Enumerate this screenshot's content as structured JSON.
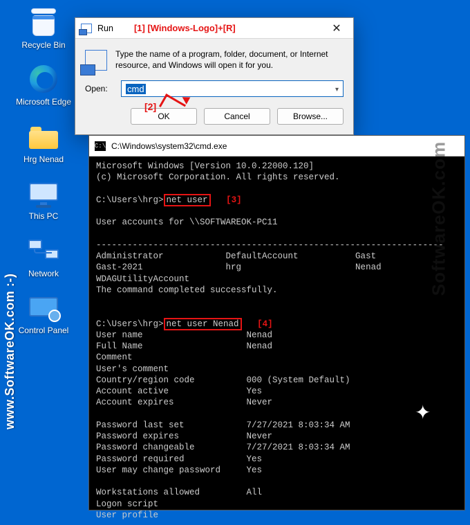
{
  "desktop": {
    "icons": [
      {
        "label": "Recycle Bin"
      },
      {
        "label": "Microsoft Edge"
      },
      {
        "label": "Hrg Nenad"
      },
      {
        "label": "This PC"
      },
      {
        "label": "Network"
      },
      {
        "label": "Control Panel"
      }
    ]
  },
  "annotations": {
    "a1": "[1]  [Windows-Logo]+[R]",
    "a2": "[2]",
    "a3": "[3]",
    "a4": "[4]"
  },
  "run": {
    "title": "Run",
    "description": "Type the name of a program, folder, document, or Internet resource, and Windows will open it for you.",
    "open_label": "Open:",
    "input_value": "cmd",
    "ok": "OK",
    "cancel": "Cancel",
    "browse": "Browse..."
  },
  "cmd": {
    "title": "C:\\Windows\\system32\\cmd.exe",
    "prompt_prefix": "C:\\Users\\hrg>",
    "command1": "net user",
    "command2": "net user Nenad",
    "lines": {
      "l1": "Microsoft Windows [Version 10.0.22000.120]",
      "l2": "(c) Microsoft Corporation. All rights reserved.",
      "l3": "User accounts for \\\\SOFTWAREOK-PC11",
      "l4": "-------------------------------------------------------------------",
      "l5": "Administrator            DefaultAccount           Gast",
      "l6": "Gast-2021                hrg                      Nenad",
      "l7": "WDAGUtilityAccount",
      "l8": "The command completed successfully.",
      "l9": "User name                    Nenad",
      "l10": "Full Name                    Nenad",
      "l11": "Comment",
      "l12": "User's comment",
      "l13": "Country/region code          000 (System Default)",
      "l14": "Account active               Yes",
      "l15": "Account expires              Never",
      "l16": "Password last set            7/27/2021 8:03:34 AM",
      "l17": "Password expires             Never",
      "l18": "Password changeable          7/27/2021 8:03:34 AM",
      "l19": "Password required            Yes",
      "l20": "User may change password     Yes",
      "l21": "Workstations allowed         All",
      "l22": "Logon script",
      "l23": "User profile"
    }
  },
  "watermark": {
    "left": "www.SoftwareOK.com  :-)",
    "right": "SoftwareOK.com"
  }
}
